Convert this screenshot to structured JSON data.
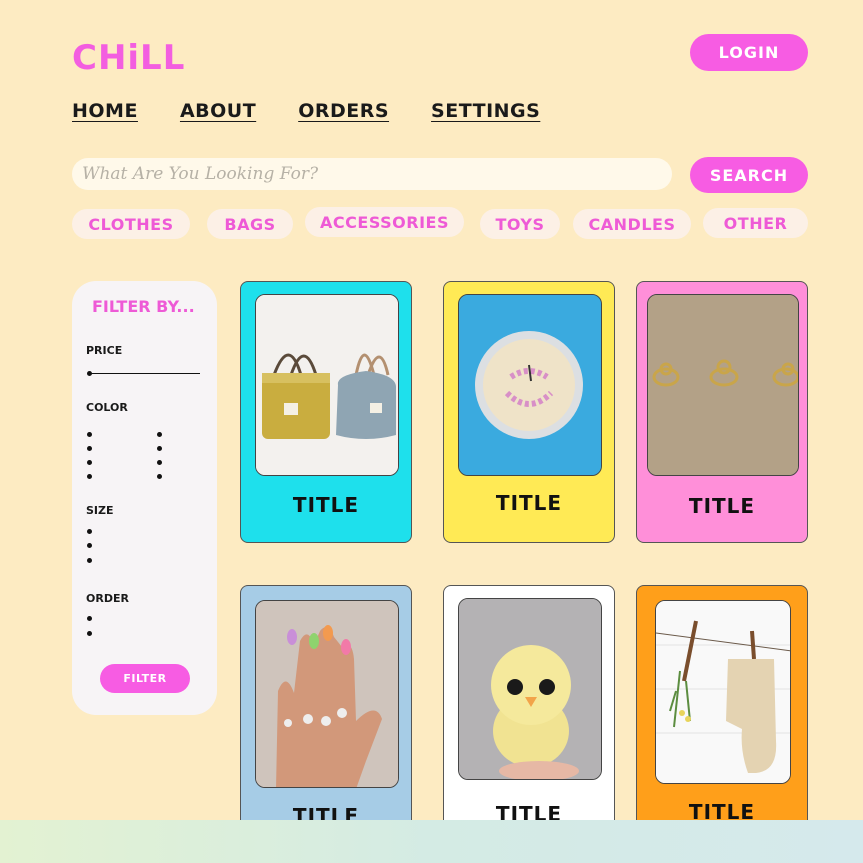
{
  "header": {
    "logo": "CHiLL",
    "login_label": "LOGIN"
  },
  "nav": [
    "HOME",
    "ABOUT",
    "ORDERS",
    "SETTINGS"
  ],
  "search": {
    "placeholder": "What Are You Looking For?",
    "button_label": "SEARCH"
  },
  "categories": [
    "CLOTHES",
    "BAGS",
    "ACCESSORIES",
    "TOYS",
    "CANDLES",
    "OTHER"
  ],
  "filters": {
    "title": "FILTER BY...",
    "price_label": "PRICE",
    "color_label": "COLOR",
    "size_label": "SIZE",
    "order_label": "ORDER",
    "button_label": "FILTER"
  },
  "products": [
    {
      "title": "TITLE",
      "bg": "#1ee0ec",
      "image": "bags-photo"
    },
    {
      "title": "TITLE",
      "bg": "#ffea55",
      "image": "candle-photo"
    },
    {
      "title": "TITLE",
      "bg": "#ff8fd9",
      "image": "rings-photo"
    },
    {
      "title": "TITLE",
      "bg": "#a6cce6",
      "image": "hand-rings-photo"
    },
    {
      "title": "TITLE",
      "bg": "#ffffff",
      "image": "crochet-chick-photo"
    },
    {
      "title": "TITLE",
      "bg": "#ff9f1a",
      "image": "socks-photo"
    }
  ],
  "colors": {
    "accent": "#f75ce3",
    "background": "#fdebc2"
  }
}
